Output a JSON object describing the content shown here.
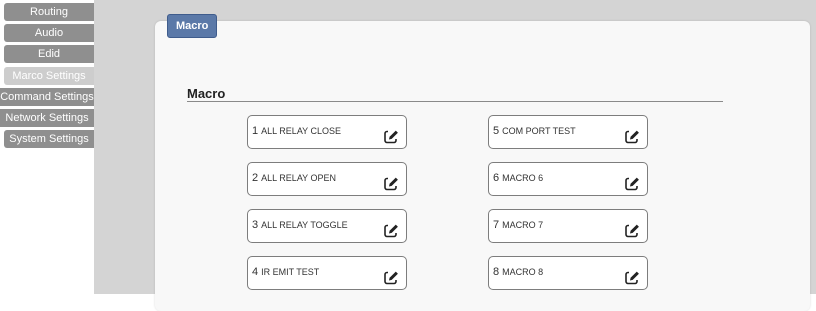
{
  "sidebar": {
    "items": [
      {
        "label": "Routing"
      },
      {
        "label": "Audio"
      },
      {
        "label": "Edid"
      },
      {
        "label": "Marco Settings"
      },
      {
        "label": "Command Settings"
      },
      {
        "label": "Network Settings"
      },
      {
        "label": "System Settings"
      }
    ]
  },
  "panel": {
    "tab_label": "Macro",
    "section_title": "Macro"
  },
  "macros": [
    {
      "num": "1",
      "name": "ALL RELAY CLOSE"
    },
    {
      "num": "2",
      "name": "ALL RELAY OPEN"
    },
    {
      "num": "3",
      "name": "ALL RELAY TOGGLE"
    },
    {
      "num": "4",
      "name": "IR EMIT TEST"
    },
    {
      "num": "5",
      "name": "COM PORT TEST"
    },
    {
      "num": "6",
      "name": "MACRO 6"
    },
    {
      "num": "7",
      "name": "MACRO 7"
    },
    {
      "num": "8",
      "name": "MACRO 8"
    }
  ],
  "icons": {
    "edit": "edit-icon"
  },
  "colors": {
    "sidebar_item": "#8f8f8f",
    "sidebar_active": "#cdcdcd",
    "tab": "#5b79a8",
    "main_bg": "#d4d4d4"
  }
}
